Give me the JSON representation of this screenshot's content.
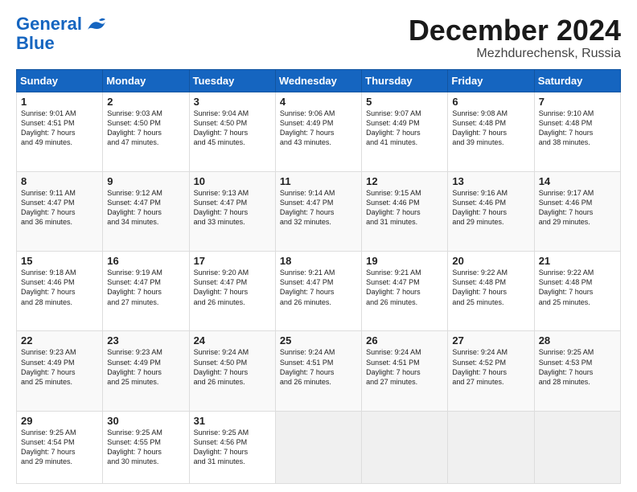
{
  "header": {
    "logo_line1": "General",
    "logo_line2": "Blue",
    "month": "December 2024",
    "location": "Mezhdurechensk, Russia"
  },
  "days_of_week": [
    "Sunday",
    "Monday",
    "Tuesday",
    "Wednesday",
    "Thursday",
    "Friday",
    "Saturday"
  ],
  "weeks": [
    [
      {
        "day": "1",
        "info": "Sunrise: 9:01 AM\nSunset: 4:51 PM\nDaylight: 7 hours\nand 49 minutes."
      },
      {
        "day": "2",
        "info": "Sunrise: 9:03 AM\nSunset: 4:50 PM\nDaylight: 7 hours\nand 47 minutes."
      },
      {
        "day": "3",
        "info": "Sunrise: 9:04 AM\nSunset: 4:50 PM\nDaylight: 7 hours\nand 45 minutes."
      },
      {
        "day": "4",
        "info": "Sunrise: 9:06 AM\nSunset: 4:49 PM\nDaylight: 7 hours\nand 43 minutes."
      },
      {
        "day": "5",
        "info": "Sunrise: 9:07 AM\nSunset: 4:49 PM\nDaylight: 7 hours\nand 41 minutes."
      },
      {
        "day": "6",
        "info": "Sunrise: 9:08 AM\nSunset: 4:48 PM\nDaylight: 7 hours\nand 39 minutes."
      },
      {
        "day": "7",
        "info": "Sunrise: 9:10 AM\nSunset: 4:48 PM\nDaylight: 7 hours\nand 38 minutes."
      }
    ],
    [
      {
        "day": "8",
        "info": "Sunrise: 9:11 AM\nSunset: 4:47 PM\nDaylight: 7 hours\nand 36 minutes."
      },
      {
        "day": "9",
        "info": "Sunrise: 9:12 AM\nSunset: 4:47 PM\nDaylight: 7 hours\nand 34 minutes."
      },
      {
        "day": "10",
        "info": "Sunrise: 9:13 AM\nSunset: 4:47 PM\nDaylight: 7 hours\nand 33 minutes."
      },
      {
        "day": "11",
        "info": "Sunrise: 9:14 AM\nSunset: 4:47 PM\nDaylight: 7 hours\nand 32 minutes."
      },
      {
        "day": "12",
        "info": "Sunrise: 9:15 AM\nSunset: 4:46 PM\nDaylight: 7 hours\nand 31 minutes."
      },
      {
        "day": "13",
        "info": "Sunrise: 9:16 AM\nSunset: 4:46 PM\nDaylight: 7 hours\nand 29 minutes."
      },
      {
        "day": "14",
        "info": "Sunrise: 9:17 AM\nSunset: 4:46 PM\nDaylight: 7 hours\nand 29 minutes."
      }
    ],
    [
      {
        "day": "15",
        "info": "Sunrise: 9:18 AM\nSunset: 4:46 PM\nDaylight: 7 hours\nand 28 minutes."
      },
      {
        "day": "16",
        "info": "Sunrise: 9:19 AM\nSunset: 4:47 PM\nDaylight: 7 hours\nand 27 minutes."
      },
      {
        "day": "17",
        "info": "Sunrise: 9:20 AM\nSunset: 4:47 PM\nDaylight: 7 hours\nand 26 minutes."
      },
      {
        "day": "18",
        "info": "Sunrise: 9:21 AM\nSunset: 4:47 PM\nDaylight: 7 hours\nand 26 minutes."
      },
      {
        "day": "19",
        "info": "Sunrise: 9:21 AM\nSunset: 4:47 PM\nDaylight: 7 hours\nand 26 minutes."
      },
      {
        "day": "20",
        "info": "Sunrise: 9:22 AM\nSunset: 4:48 PM\nDaylight: 7 hours\nand 25 minutes."
      },
      {
        "day": "21",
        "info": "Sunrise: 9:22 AM\nSunset: 4:48 PM\nDaylight: 7 hours\nand 25 minutes."
      }
    ],
    [
      {
        "day": "22",
        "info": "Sunrise: 9:23 AM\nSunset: 4:49 PM\nDaylight: 7 hours\nand 25 minutes."
      },
      {
        "day": "23",
        "info": "Sunrise: 9:23 AM\nSunset: 4:49 PM\nDaylight: 7 hours\nand 25 minutes."
      },
      {
        "day": "24",
        "info": "Sunrise: 9:24 AM\nSunset: 4:50 PM\nDaylight: 7 hours\nand 26 minutes."
      },
      {
        "day": "25",
        "info": "Sunrise: 9:24 AM\nSunset: 4:51 PM\nDaylight: 7 hours\nand 26 minutes."
      },
      {
        "day": "26",
        "info": "Sunrise: 9:24 AM\nSunset: 4:51 PM\nDaylight: 7 hours\nand 27 minutes."
      },
      {
        "day": "27",
        "info": "Sunrise: 9:24 AM\nSunset: 4:52 PM\nDaylight: 7 hours\nand 27 minutes."
      },
      {
        "day": "28",
        "info": "Sunrise: 9:25 AM\nSunset: 4:53 PM\nDaylight: 7 hours\nand 28 minutes."
      }
    ],
    [
      {
        "day": "29",
        "info": "Sunrise: 9:25 AM\nSunset: 4:54 PM\nDaylight: 7 hours\nand 29 minutes."
      },
      {
        "day": "30",
        "info": "Sunrise: 9:25 AM\nSunset: 4:55 PM\nDaylight: 7 hours\nand 30 minutes."
      },
      {
        "day": "31",
        "info": "Sunrise: 9:25 AM\nSunset: 4:56 PM\nDaylight: 7 hours\nand 31 minutes."
      },
      null,
      null,
      null,
      null
    ]
  ]
}
